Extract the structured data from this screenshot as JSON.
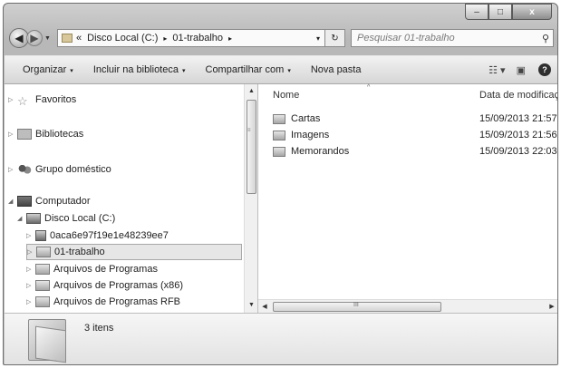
{
  "window": {
    "caption": {
      "minimize": "–",
      "maximize": "□",
      "close": "x"
    }
  },
  "address_bar": {
    "overflow": "«",
    "crumbs": [
      "Disco Local (C:)",
      "01-trabalho"
    ],
    "separator": "▸",
    "dropdown": "▾",
    "refresh": "↻"
  },
  "search": {
    "placeholder": "Pesquisar 01-trabalho",
    "icon": "search-icon"
  },
  "toolbar": {
    "organize": "Organizar",
    "include": "Incluir na biblioteca",
    "share": "Compartilhar com",
    "new_folder": "Nova pasta",
    "caret": "▾"
  },
  "nav": {
    "favorites": "Favoritos",
    "libraries": "Bibliotecas",
    "homegroup": "Grupo doméstico",
    "computer": "Computador",
    "local_disk": "Disco Local (C:)",
    "items": [
      "0aca6e97f19e1e48239ee7",
      "01-trabalho",
      "Arquivos de Programas",
      "Arquivos de Programas (x86)",
      "Arquivos de Programas RFB"
    ],
    "selected_item": "01-trabalho"
  },
  "content": {
    "columns": {
      "name": "Nome",
      "date": "Data de modificaç"
    },
    "files": [
      {
        "name": "Cartas",
        "date": "15/09/2013 21:57"
      },
      {
        "name": "Imagens",
        "date": "15/09/2013 21:56"
      },
      {
        "name": "Memorandos",
        "date": "15/09/2013 22:03"
      }
    ]
  },
  "status": {
    "count": "3 itens"
  },
  "scroll": {
    "grip_v": "≡",
    "grip_h": "III"
  },
  "colors": {
    "accent": "#2e2e2e",
    "background": "#ffffff"
  }
}
